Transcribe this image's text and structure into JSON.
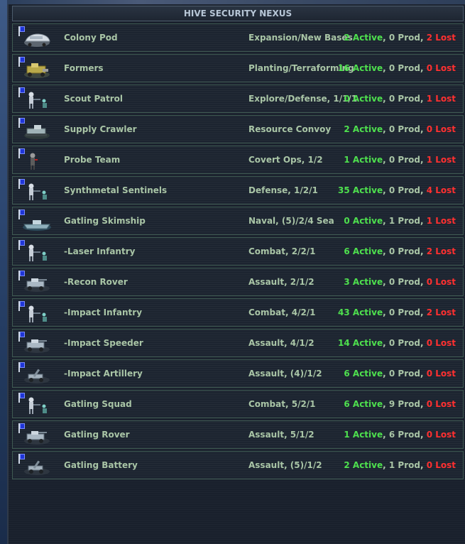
{
  "title": "HIVE SECURITY NEXUS",
  "colors": {
    "active": "#4ee04e",
    "lost": "#ff3030",
    "text": "#a9c5a6",
    "flag": "#1f35d8"
  },
  "units": [
    {
      "name": "Colony Pod",
      "role": "Expansion/New Bases",
      "active": "2 Active",
      "prod": "0 Prod",
      "lost": "2 Lost",
      "icon": "colony-pod-icon"
    },
    {
      "name": "Formers",
      "role": "Planting/Terraforming",
      "active": "16 Active",
      "prod": "0 Prod",
      "lost": "0 Lost",
      "icon": "formers-icon"
    },
    {
      "name": "Scout Patrol",
      "role": "Explore/Defense, 1/1/1",
      "active": "0 Active",
      "prod": "0 Prod",
      "lost": "1 Lost",
      "icon": "infantry-icon"
    },
    {
      "name": "Supply Crawler",
      "role": "Resource Convoy",
      "active": "2 Active",
      "prod": "0 Prod",
      "lost": "0 Lost",
      "icon": "crawler-icon"
    },
    {
      "name": "Probe Team",
      "role": "Covert Ops, 1/2",
      "active": "1 Active",
      "prod": "0 Prod",
      "lost": "1 Lost",
      "icon": "probe-team-icon"
    },
    {
      "name": "Synthmetal Sentinels",
      "role": "Defense, 1/2/1",
      "active": "35 Active",
      "prod": "0 Prod",
      "lost": "4 Lost",
      "icon": "infantry-icon"
    },
    {
      "name": "Gatling Skimship",
      "role": "Naval, (5)/2/4 Sea",
      "active": "0 Active",
      "prod": "1 Prod",
      "lost": "1 Lost",
      "icon": "skimship-icon"
    },
    {
      "name": "-Laser Infantry",
      "role": "Combat, 2/2/1",
      "active": "6 Active",
      "prod": "0 Prod",
      "lost": "2 Lost",
      "icon": "infantry-icon"
    },
    {
      "name": "-Recon Rover",
      "role": "Assault, 2/1/2",
      "active": "3 Active",
      "prod": "0 Prod",
      "lost": "0 Lost",
      "icon": "rover-icon"
    },
    {
      "name": "-Impact Infantry",
      "role": "Combat, 4/2/1",
      "active": "43 Active",
      "prod": "0 Prod",
      "lost": "2 Lost",
      "icon": "infantry-icon"
    },
    {
      "name": "-Impact Speeder",
      "role": "Assault, 4/1/2",
      "active": "14 Active",
      "prod": "0 Prod",
      "lost": "0 Lost",
      "icon": "rover-icon"
    },
    {
      "name": "-Impact Artillery",
      "role": "Assault, (4)/1/2",
      "active": "6 Active",
      "prod": "0 Prod",
      "lost": "0 Lost",
      "icon": "artillery-icon"
    },
    {
      "name": "Gatling Squad",
      "role": "Combat, 5/2/1",
      "active": "6 Active",
      "prod": "9 Prod",
      "lost": "0 Lost",
      "icon": "infantry-icon"
    },
    {
      "name": "Gatling Rover",
      "role": "Assault, 5/1/2",
      "active": "1 Active",
      "prod": "6 Prod",
      "lost": "0 Lost",
      "icon": "rover-icon"
    },
    {
      "name": "Gatling Battery",
      "role": "Assault, (5)/1/2",
      "active": "2 Active",
      "prod": "1 Prod",
      "lost": "0 Lost",
      "icon": "artillery-icon"
    }
  ]
}
